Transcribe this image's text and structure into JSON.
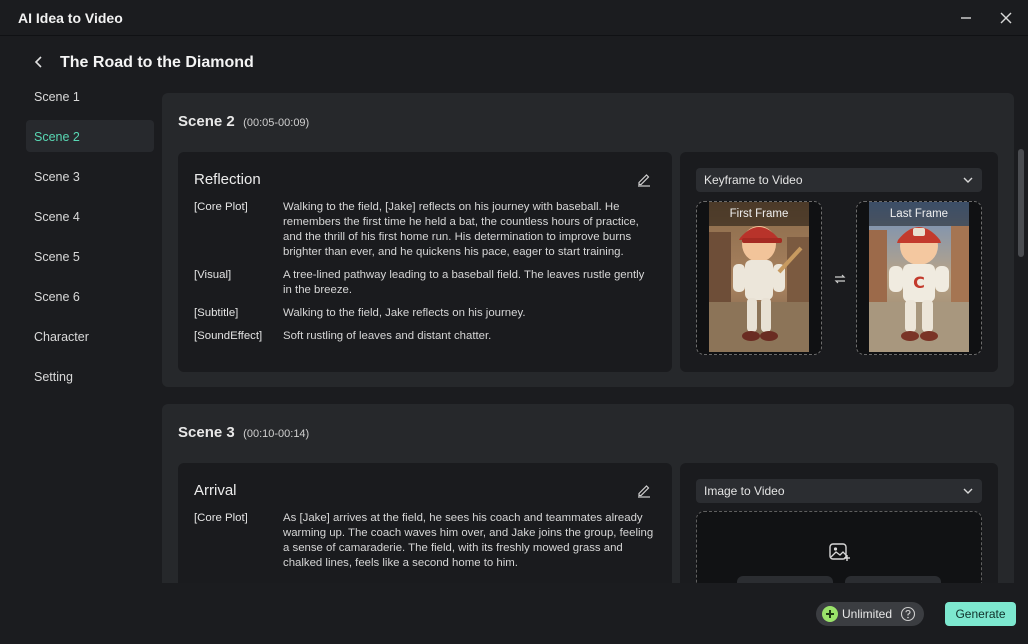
{
  "window": {
    "title": "AI Idea to Video"
  },
  "header": {
    "title": "The Road to the Diamond"
  },
  "sidebar": {
    "items": [
      {
        "label": "Scene 1"
      },
      {
        "label": "Scene 2"
      },
      {
        "label": "Scene 3"
      },
      {
        "label": "Scene 4"
      },
      {
        "label": "Scene 5"
      },
      {
        "label": "Scene 6"
      },
      {
        "label": "Character"
      },
      {
        "label": "Setting"
      }
    ]
  },
  "scenes": [
    {
      "name": "Scene 2",
      "time": "(00:05-00:09)",
      "title": "Reflection",
      "fields": [
        {
          "key": "[Core Plot]",
          "value": "Walking to the field, [Jake] reflects on his journey with baseball. He remembers the first time he held a bat, the countless hours of practice, and the thrill of his first home run. His determination to improve burns brighter than ever, and he quickens his pace, eager to start training."
        },
        {
          "key": "[Visual]",
          "value": "A tree-lined pathway leading to a baseball field. The leaves rustle gently in the breeze."
        },
        {
          "key": "[Subtitle]",
          "value": "Walking to the field, Jake reflects on his journey."
        },
        {
          "key": "[SoundEffect]",
          "value": "Soft rustling of leaves and distant chatter."
        }
      ],
      "mode": "Keyframe to Video",
      "first_frame_label": "First Frame",
      "last_frame_label": "Last Frame"
    },
    {
      "name": "Scene 3",
      "time": "(00:10-00:14)",
      "title": "Arrival",
      "fields": [
        {
          "key": "[Core Plot]",
          "value": "As [Jake] arrives at the field, he sees his coach and teammates already warming up. The coach waves him over, and Jake joins the group, feeling a sense of camaraderie. The field, with its freshly mowed grass and chalked lines, feels like a second home to him."
        }
      ],
      "mode": "Image to Video"
    }
  ],
  "footer": {
    "unlimited_label": "Unlimited",
    "generate_label": "Generate"
  },
  "colors": {
    "accent": "#59d8b4",
    "generate_bg": "#7de8cf",
    "panel": "#26282b",
    "card": "#1a1b1e"
  }
}
